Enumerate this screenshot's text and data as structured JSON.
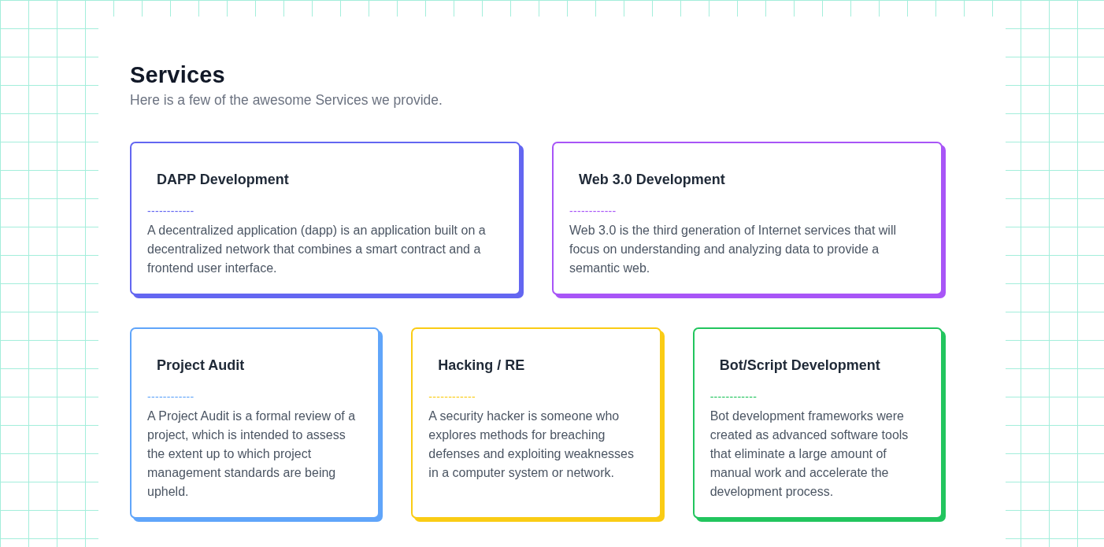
{
  "header": {
    "title": "Services",
    "subtitle": "Here is a few of the awesome Services we provide."
  },
  "rows": [
    {
      "cards": [
        {
          "title": "DAPP Development",
          "divider": "------------",
          "description": "A decentralized application (dapp) is an application built on a decentralized network that combines a smart contract and a frontend user interface.",
          "color": "#6366f1"
        },
        {
          "title": "Web 3.0 Development",
          "divider": "------------",
          "description": "Web 3.0 is the third generation of Internet services that will focus on understanding and analyzing data to provide a semantic web.",
          "color": "#a855f7"
        }
      ]
    },
    {
      "cards": [
        {
          "title": "Project Audit",
          "divider": "------------",
          "description": "A Project Audit is a formal review of a project, which is intended to assess the extent up to which project management standards are being upheld.",
          "color": "#60a5fa"
        },
        {
          "title": "Hacking / RE",
          "divider": "------------",
          "description": "A security hacker is someone who explores methods for breaching defenses and exploiting weaknesses in a computer system or network.",
          "color": "#facc15"
        },
        {
          "title": "Bot/Script Development",
          "divider": "------------",
          "description": "Bot development frameworks were created as advanced software tools that eliminate a large amount of manual work and accelerate the development process.",
          "color": "#22c55e"
        }
      ]
    }
  ]
}
